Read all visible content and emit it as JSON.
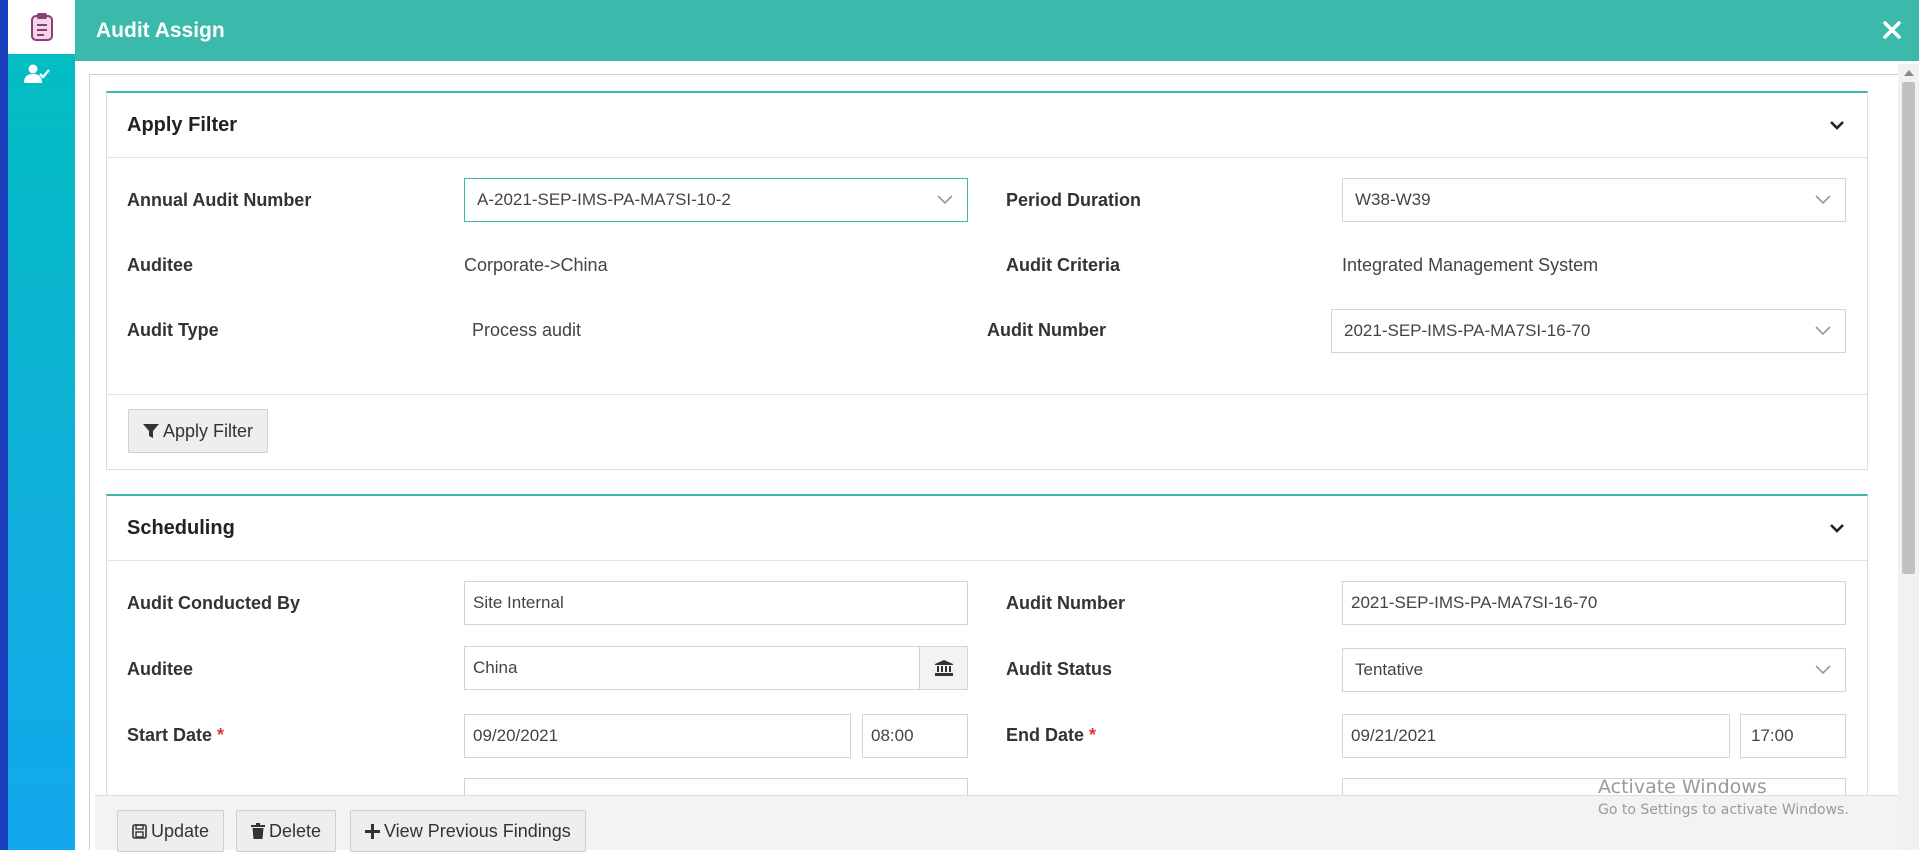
{
  "header": {
    "title": "Audit Assign"
  },
  "sidebar": {
    "icons": [
      "clipboard-icon",
      "user-check-icon"
    ]
  },
  "apply_filter": {
    "title": "Apply Filter",
    "annual_audit_number_label": "Annual Audit Number",
    "annual_audit_number_value": "A-2021-SEP-IMS-PA-MA7SI-10-2",
    "period_duration_label": "Period Duration",
    "period_duration_value": "W38-W39",
    "auditee_label": "Auditee",
    "auditee_value": "Corporate->China",
    "audit_criteria_label": "Audit Criteria",
    "audit_criteria_value": "Integrated Management System",
    "audit_type_label": "Audit Type",
    "audit_type_value": "Process audit",
    "audit_number_label": "Audit Number",
    "audit_number_value": "2021-SEP-IMS-PA-MA7SI-16-70",
    "button_label": "Apply Filter"
  },
  "scheduling": {
    "title": "Scheduling",
    "conducted_by_label": "Audit Conducted By",
    "conducted_by_value": "Site Internal",
    "audit_number_label": "Audit Number",
    "audit_number_value": "2021-SEP-IMS-PA-MA7SI-16-70",
    "auditee_label": "Auditee",
    "auditee_value": "China",
    "audit_status_label": "Audit Status",
    "audit_status_value": "Tentative",
    "start_date_label": "Start Date",
    "start_date_value": "09/20/2021",
    "start_time_value": "08:00",
    "end_date_label": "End Date",
    "end_date_value": "09/21/2021",
    "end_time_value": "17:00",
    "required_mark": "*"
  },
  "footer": {
    "update_label": "Update",
    "delete_label": "Delete",
    "view_findings_label": "View Previous Findings"
  },
  "watermark": {
    "title": "Activate Windows",
    "subtitle": "Go to Settings to activate Windows."
  },
  "colors": {
    "accent": "#3bb9aa",
    "rail_top": "#00bfbf",
    "rail_bottom": "#12a8ee",
    "required": "#d9353b"
  }
}
